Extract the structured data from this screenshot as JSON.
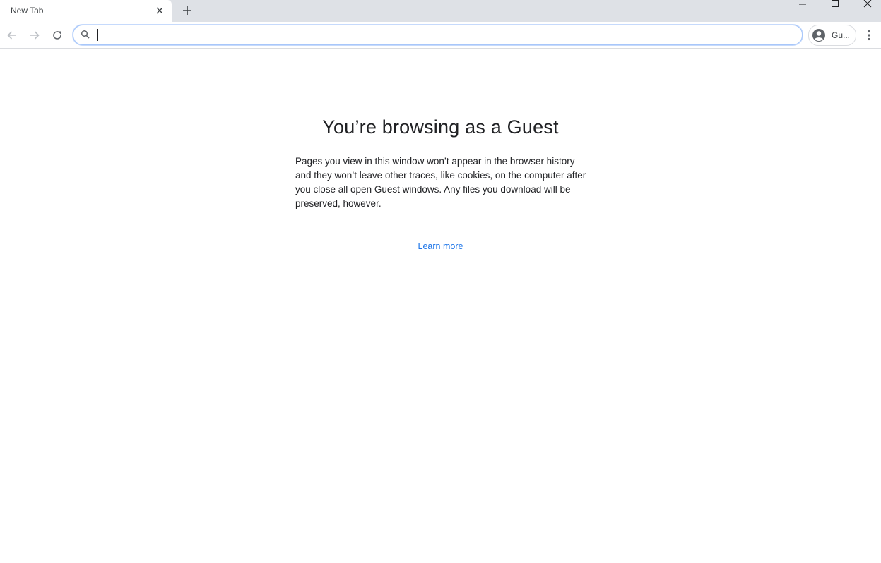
{
  "tabs": [
    {
      "title": "New Tab"
    }
  ],
  "omnibox": {
    "value": "",
    "placeholder": ""
  },
  "profile": {
    "label": "Gu..."
  },
  "guest_page": {
    "title": "You’re browsing as a Guest",
    "description": "Pages you view in this window won’t appear in the browser history and they won’t leave other traces, like cookies, on the computer after you close all open Guest windows. Any files you download will be preserved, however.",
    "learn_more": "Learn more"
  },
  "colors": {
    "tabstrip_bg": "#dee1e6",
    "link": "#1a73e8",
    "omnibox_focus": "#a8c7fa"
  },
  "icons": [
    "close-icon",
    "plus-icon",
    "minimize-icon",
    "maximize-icon",
    "window-close-icon",
    "back-arrow-icon",
    "forward-arrow-icon",
    "reload-icon",
    "search-icon",
    "avatar-icon",
    "kebab-menu-icon"
  ]
}
